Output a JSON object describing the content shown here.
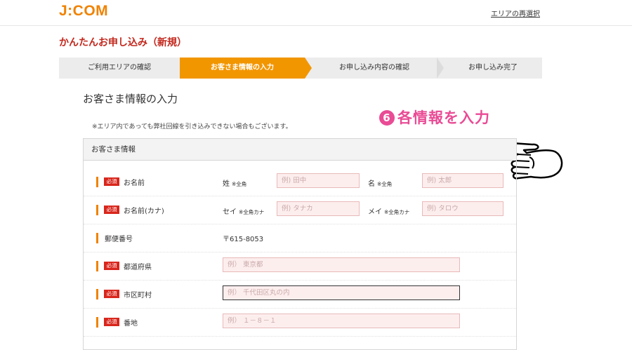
{
  "header": {
    "logo": "J:COM",
    "area_link": "エリアの再選択"
  },
  "page_title": "かんたんお申し込み（新規）",
  "steps": [
    {
      "label": "ご利用エリアの確認",
      "active": false
    },
    {
      "label": "お客さま情報の入力",
      "active": true
    },
    {
      "label": "お申し込み内容の確認",
      "active": false
    },
    {
      "label": "お申し込み完了",
      "active": false
    }
  ],
  "section_title": "お客さま情報の入力",
  "note": "※エリア内であっても弊社回線を引き込みできない場合もございます。",
  "annotation": {
    "number": "6",
    "text": "各情報を入力"
  },
  "panel_title": "お客さま情報",
  "required_badge": "必須",
  "form": {
    "name": {
      "label": "お名前",
      "sei_label": "姓",
      "sei_note": "※全角",
      "sei_placeholder": "例) 田中",
      "mei_label": "名",
      "mei_note": "※全角",
      "mei_placeholder": "例) 太郎"
    },
    "kana": {
      "label": "お名前(カナ)",
      "sei_label": "セイ",
      "sei_note": "※全角カナ",
      "sei_placeholder": "例) タナカ",
      "mei_label": "メイ",
      "mei_note": "※全角カナ",
      "mei_placeholder": "例) タロウ"
    },
    "postal": {
      "label": "郵便番号",
      "value": "〒615-8053"
    },
    "prefecture": {
      "label": "都道府県",
      "placeholder": "例） 東京都"
    },
    "city": {
      "label": "市区町村",
      "placeholder": "例） 千代田区丸の内"
    },
    "address": {
      "label": "番地",
      "placeholder": "例） １－８－１"
    }
  }
}
